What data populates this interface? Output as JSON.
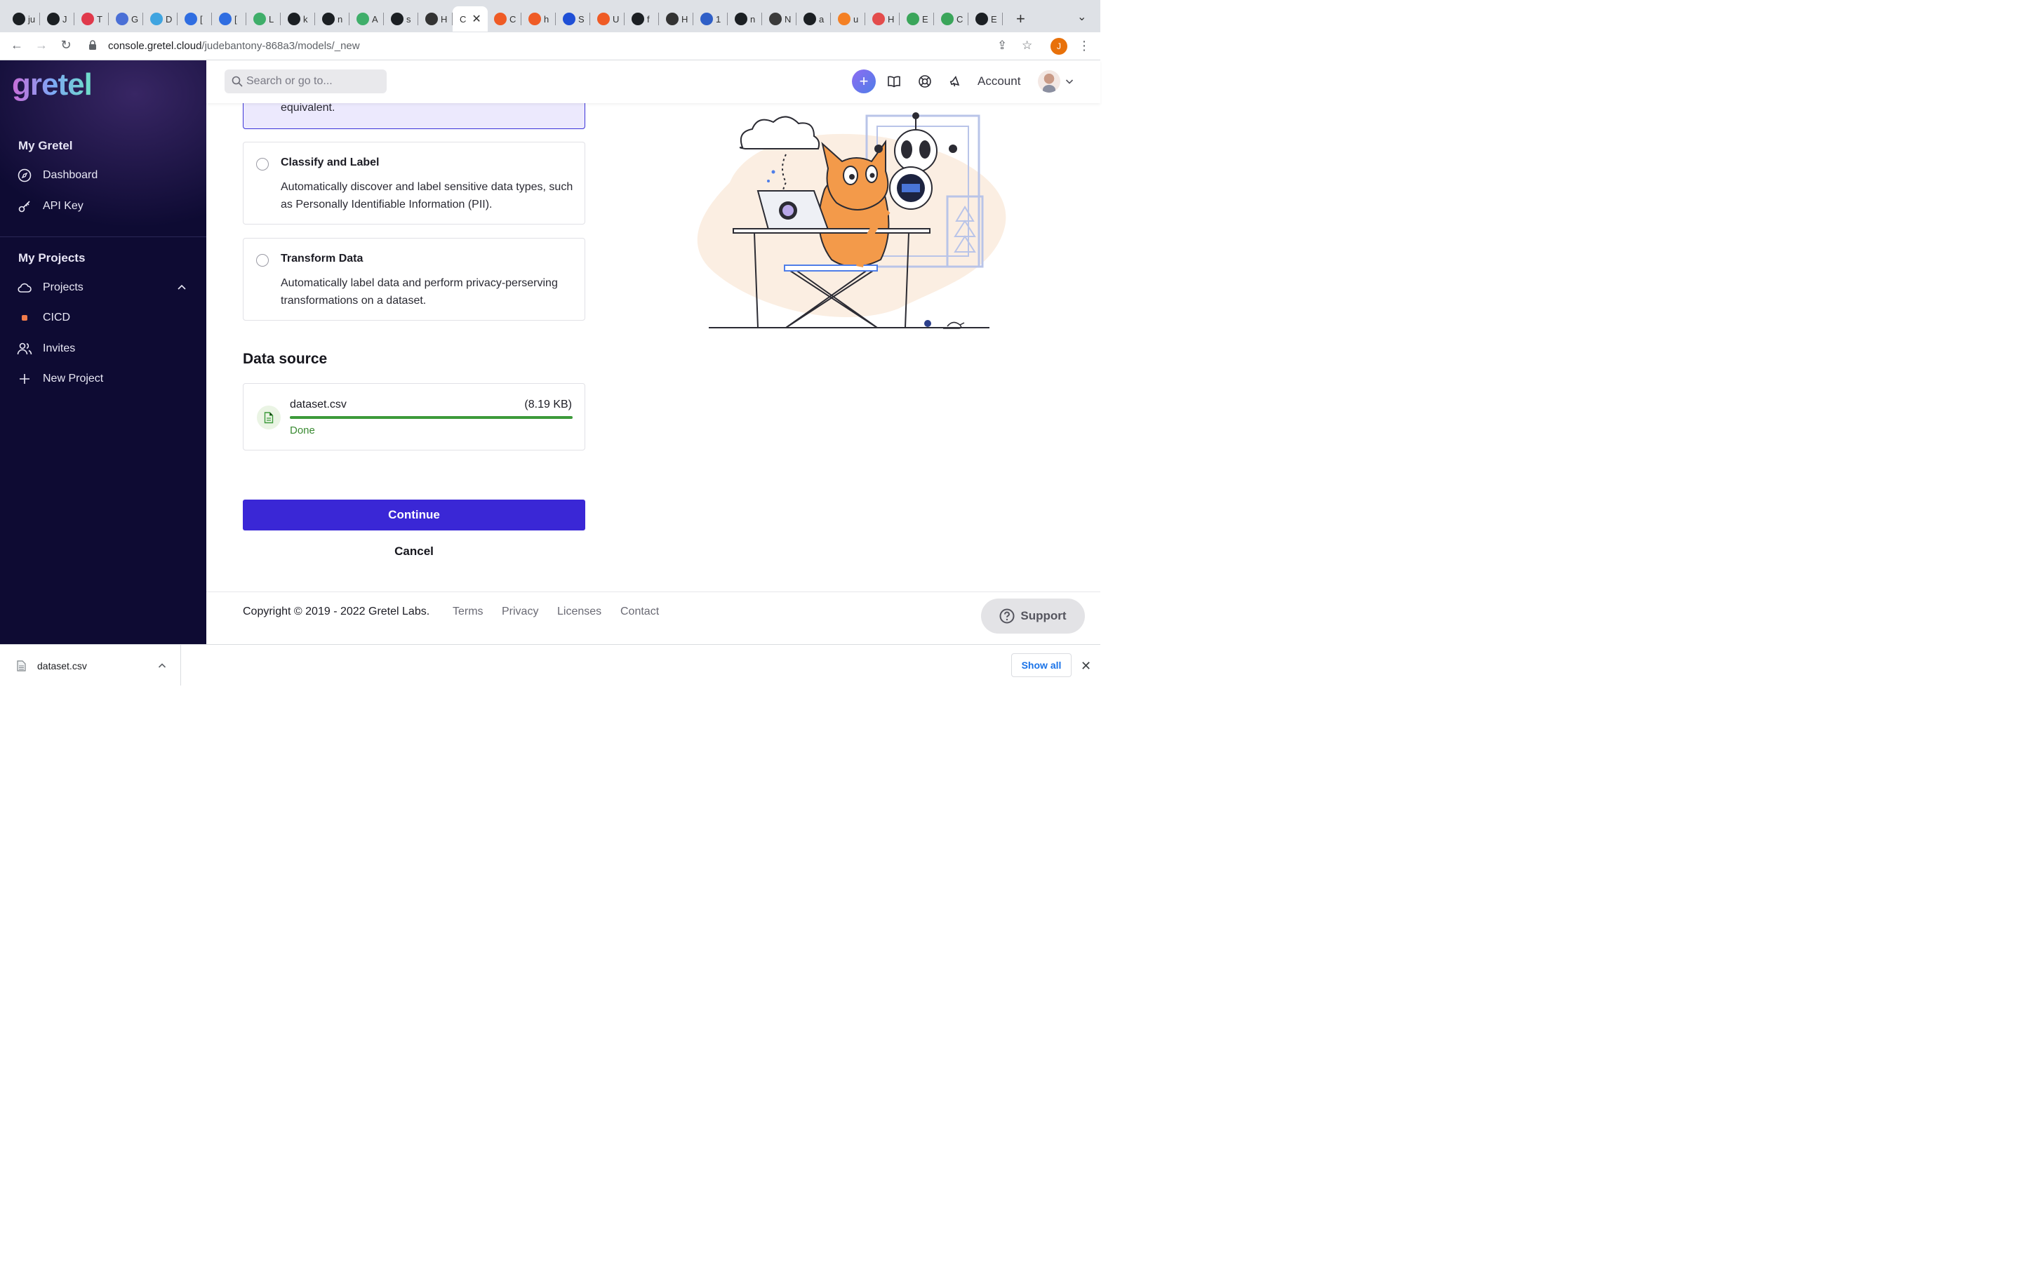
{
  "browser": {
    "tabs": [
      {
        "label": "ju",
        "icon": "github-icon",
        "color": "#1b1f23"
      },
      {
        "label": "J",
        "icon": "github-icon",
        "color": "#1b1f23"
      },
      {
        "label": "T",
        "icon": "diamond-icon",
        "color": "#e0394b"
      },
      {
        "label": "G",
        "icon": "hexagon-icon",
        "color": "#4a6fd6"
      },
      {
        "label": "D",
        "icon": "doc-icon",
        "color": "#3fa4e0"
      },
      {
        "label": "[",
        "icon": "jira-icon",
        "color": "#2f6de1"
      },
      {
        "label": "[",
        "icon": "jira-icon",
        "color": "#2f6de1"
      },
      {
        "label": "L",
        "icon": "kotlin-icon",
        "color": "#3fae6a"
      },
      {
        "label": "k",
        "icon": "github-icon",
        "color": "#1b1f23"
      },
      {
        "label": "n",
        "icon": "github-icon",
        "color": "#1b1f23"
      },
      {
        "label": "A",
        "icon": "kotlin-icon",
        "color": "#3fae6a"
      },
      {
        "label": "s",
        "icon": "github-icon",
        "color": "#1b1f23"
      },
      {
        "label": "H",
        "icon": "gear-icon",
        "color": "#333333"
      },
      {
        "label": "C",
        "icon": "",
        "color": "#ffffff",
        "active": true
      },
      {
        "label": "C",
        "icon": "postman-icon",
        "color": "#ef5b25"
      },
      {
        "label": "h",
        "icon": "postman-icon",
        "color": "#ef5b25"
      },
      {
        "label": "S",
        "icon": "k-icon",
        "color": "#1f4fd6"
      },
      {
        "label": "U",
        "icon": "postman-icon",
        "color": "#ef5b25"
      },
      {
        "label": "f",
        "icon": "github-icon",
        "color": "#1b1f23"
      },
      {
        "label": "H",
        "icon": "gear-icon",
        "color": "#333333"
      },
      {
        "label": "1",
        "icon": "kubeflow-icon",
        "color": "#2f5fc7"
      },
      {
        "label": "n",
        "icon": "github-icon",
        "color": "#1b1f23"
      },
      {
        "label": "N",
        "icon": "chrome-icon",
        "color": "#3b3b3b"
      },
      {
        "label": "a",
        "icon": "github-icon",
        "color": "#1b1f23"
      },
      {
        "label": "u",
        "icon": "stack-icon",
        "color": "#f48024"
      },
      {
        "label": "H",
        "icon": "help-icon",
        "color": "#e34c4c"
      },
      {
        "label": "E",
        "icon": "gretel-icon",
        "color": "#3aa55a"
      },
      {
        "label": "C",
        "icon": "gretel-icon",
        "color": "#3aa55a"
      },
      {
        "label": "E",
        "icon": "github-icon",
        "color": "#1b1f23"
      }
    ],
    "url_host": "console.gretel.cloud",
    "url_path": "/judebantony-868a3/models/_new",
    "profile_initial": "J"
  },
  "sidebar": {
    "logo": "gretel",
    "section_my_gretel": "My Gretel",
    "dashboard": "Dashboard",
    "api_key": "API Key",
    "section_my_projects": "My Projects",
    "projects": "Projects",
    "project_cicd": "CICD",
    "invites": "Invites",
    "new_project": "New Project"
  },
  "topbar": {
    "search_placeholder": "Search or go to...",
    "account": "Account"
  },
  "main": {
    "selected_option_tail": "equivalent.",
    "options": [
      {
        "title": "Classify and Label",
        "desc": "Automatically discover and label sensitive data types, such as Personally Identifiable Information (PII)."
      },
      {
        "title": "Transform Data",
        "desc": "Automatically label data and perform privacy-perserving transformations on a dataset."
      }
    ],
    "data_source_heading": "Data source",
    "file": {
      "name": "dataset.csv",
      "size": "(8.19 KB)",
      "status": "Done",
      "progress": 1.0
    },
    "continue_label": "Continue",
    "cancel_label": "Cancel"
  },
  "footer": {
    "copyright": "Copyright © 2019 - 2022 Gretel Labs.",
    "links": [
      "Terms",
      "Privacy",
      "Licenses",
      "Contact"
    ],
    "support": "Support"
  },
  "downloads": {
    "file": "dataset.csv",
    "show_all": "Show all"
  }
}
